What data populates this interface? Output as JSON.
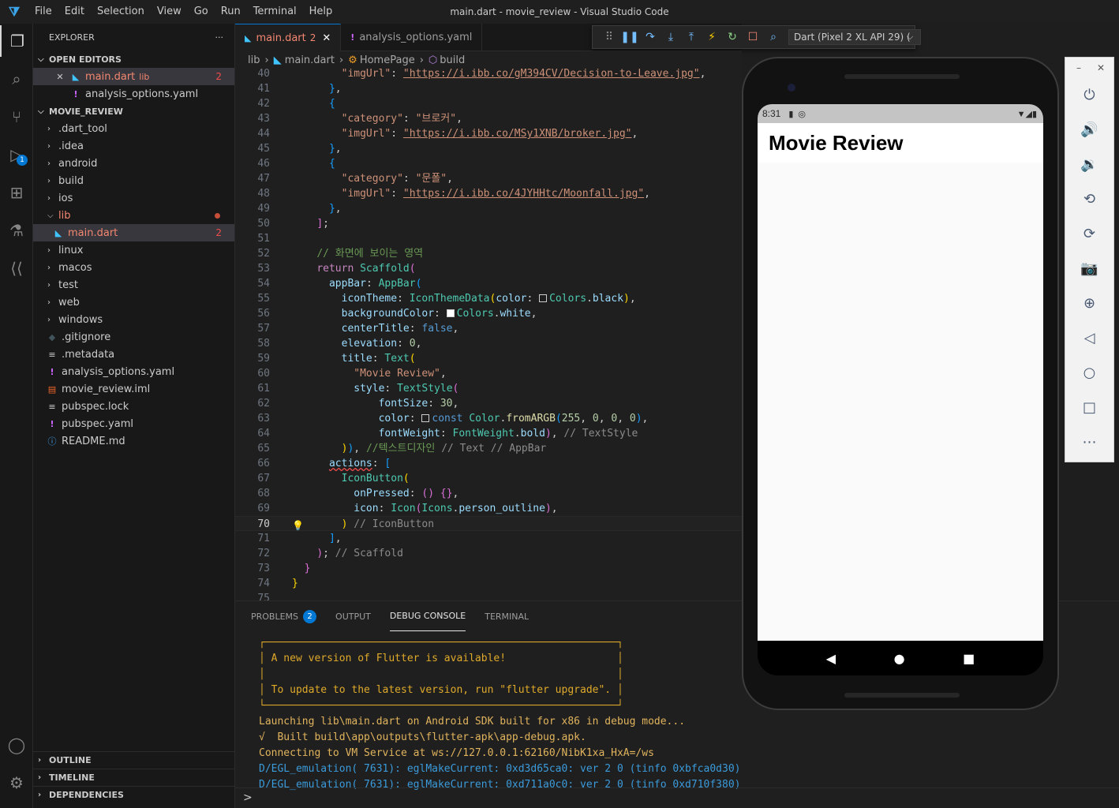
{
  "window": {
    "title": "main.dart - movie_review - Visual Studio Code",
    "menu": [
      "File",
      "Edit",
      "Selection",
      "View",
      "Go",
      "Run",
      "Terminal",
      "Help"
    ]
  },
  "activity_bar": {
    "items": [
      "explorer-icon",
      "search-icon",
      "source-control-icon",
      "run-debug-icon",
      "extensions-icon",
      "testing-icon",
      "flutter-icon"
    ],
    "debug_badge": "1",
    "bottom": [
      "account-icon",
      "settings-gear-icon"
    ]
  },
  "sidebar": {
    "title": "EXPLORER",
    "more": "···",
    "open_editors": {
      "label": "OPEN EDITORS",
      "files": [
        {
          "name": "main.dart",
          "folder": "lib",
          "count": "2"
        },
        {
          "name": "analysis_options.yaml"
        }
      ]
    },
    "project": {
      "label": "MOVIE_REVIEW",
      "items": [
        ".dart_tool",
        ".idea",
        "android",
        "build",
        "ios",
        "lib",
        "main.dart",
        "linux",
        "macos",
        "test",
        "web",
        "windows",
        ".gitignore",
        ".metadata",
        "analysis_options.yaml",
        "movie_review.iml",
        "pubspec.lock",
        "pubspec.yaml",
        "README.md"
      ],
      "main_count": "2"
    },
    "outline": "OUTLINE",
    "timeline": "TIMELINE",
    "dependencies": "DEPENDENCIES"
  },
  "tabs": [
    {
      "label": "main.dart",
      "count": "2"
    },
    {
      "label": "analysis_options.yaml"
    }
  ],
  "debug_toolbar": {
    "device": "Dart (Pixel 2 XL API 29) ("
  },
  "breadcrumb": [
    "lib",
    "main.dart",
    "HomePage",
    "build"
  ],
  "editor": {
    "line_numbers": [
      "40",
      "41",
      "42",
      "43",
      "44",
      "45",
      "46",
      "47",
      "48",
      "49",
      "50",
      "51",
      "52",
      "53",
      "54",
      "55",
      "56",
      "57",
      "58",
      "59",
      "60",
      "61",
      "62",
      "63",
      "64",
      "65",
      "66",
      "67",
      "68",
      "69",
      "70",
      "71",
      "72",
      "73",
      "74",
      "75"
    ],
    "current_line": "70"
  },
  "panel": {
    "tabs": [
      "PROBLEMS",
      "OUTPUT",
      "DEBUG CONSOLE",
      "TERMINAL"
    ],
    "problems_count": "2",
    "console": [
      "┌─────────────────────────────────────────────────────────┐",
      "│ A new version of Flutter is available!                  │",
      "│                                                         │",
      "│ To update to the latest version, run \"flutter upgrade\". │",
      "└─────────────────────────────────────────────────────────┘",
      "Launching lib\\main.dart on Android SDK built for x86 in debug mode...",
      "√  Built build\\app\\outputs\\flutter-apk\\app-debug.apk.",
      "Connecting to VM Service at ws://127.0.0.1:62160/NibK1xa_HxA=/ws",
      "D/EGL_emulation( 7631): eglMakeCurrent: 0xd3d65ca0: ver 2 0 (tinfo 0xbfca0d30)",
      "D/EGL_emulation( 7631): eglMakeCurrent: 0xd711a0c0: ver 2 0 (tinfo 0xd710f380)"
    ],
    "prompt": ">"
  },
  "emulator": {
    "time": "8:31",
    "app_title": "Movie Review",
    "window_controls": [
      "–",
      "✕"
    ],
    "tools": [
      "power-icon",
      "volume-up-icon",
      "volume-down-icon",
      "rotate-left-icon",
      "rotate-right-icon",
      "camera-icon",
      "zoom-icon",
      "back-icon",
      "home-icon",
      "overview-icon",
      "more-icon"
    ]
  },
  "colors": {
    "accent": "#0078d4",
    "error": "#f48771"
  }
}
